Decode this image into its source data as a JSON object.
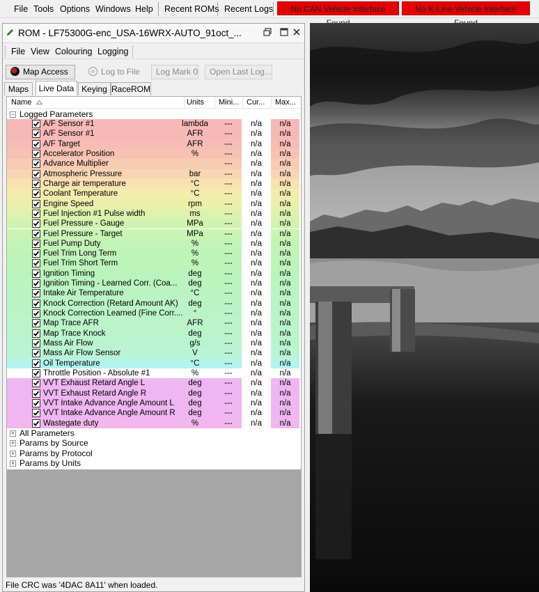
{
  "app_menu": {
    "items": [
      "File",
      "Tools",
      "Options",
      "Windows",
      "Help",
      "Recent ROMs",
      "Recent Logs"
    ],
    "errors": [
      "No CAN Vehicle Interface Found",
      "No K-Line Vehicle Interface Found"
    ]
  },
  "rom_window": {
    "title": "ROM - LF75300G-enc_USA-16WRX-AUTO_91oct_...",
    "menu": [
      "File",
      "View",
      "Colouring",
      "Logging"
    ],
    "toolbar": {
      "map_access": "Map Access",
      "log_to_file": "Log to File",
      "log_mark": "Log Mark 0",
      "open_last_log": "Open Last Log..."
    },
    "tabs": [
      "Maps",
      "Live Data",
      "Keying",
      "RaceROM"
    ],
    "active_tab": "Live Data",
    "columns": [
      "Name",
      "Units",
      "Mini...",
      "Cur...",
      "Max..."
    ],
    "tree_root": "Logged Parameters",
    "parameters": [
      {
        "name": "A/F Sensor #1",
        "units": "lambda",
        "min": "---",
        "cur": "n/a",
        "max": "n/a",
        "color": "#f7b9b6"
      },
      {
        "name": "A/F Sensor #1",
        "units": "AFR",
        "min": "---",
        "cur": "n/a",
        "max": "n/a",
        "color": "#f7b9b6"
      },
      {
        "name": "A/F Target",
        "units": "AFR",
        "min": "---",
        "cur": "n/a",
        "max": "n/a",
        "color": "#f7bcb3"
      },
      {
        "name": "Accelerator Position",
        "units": "%",
        "min": "---",
        "cur": "n/a",
        "max": "n/a",
        "color": "#f8c2b3"
      },
      {
        "name": "Advance Multiplier",
        "units": "",
        "min": "---",
        "cur": "n/a",
        "max": "n/a",
        "color": "#f8cbb3"
      },
      {
        "name": "Atmospheric Pressure",
        "units": "bar",
        "min": "---",
        "cur": "n/a",
        "max": "n/a",
        "color": "#f8d6b3"
      },
      {
        "name": "Charge air temperature",
        "units": "°C",
        "min": "---",
        "cur": "n/a",
        "max": "n/a",
        "color": "#f7e2b0"
      },
      {
        "name": "Coolant Temperature",
        "units": "°C",
        "min": "---",
        "cur": "n/a",
        "max": "n/a",
        "color": "#f3ecad"
      },
      {
        "name": "Engine Speed",
        "units": "rpm",
        "min": "---",
        "cur": "n/a",
        "max": "n/a",
        "color": "#eaf0ab"
      },
      {
        "name": "Fuel Injection #1 Pulse width",
        "units": "ms",
        "min": "---",
        "cur": "n/a",
        "max": "n/a",
        "color": "#ddf2ad"
      },
      {
        "name": "Fuel Pressure - Gauge",
        "units": "MPa",
        "min": "---",
        "cur": "n/a",
        "max": "n/a",
        "color": "#d1f3b0"
      },
      {
        "name": "Fuel Pressure - Target",
        "units": "MPa",
        "min": "---",
        "cur": "n/a",
        "max": "n/a",
        "color": "#c9f4b3"
      },
      {
        "name": "Fuel Pump Duty",
        "units": "%",
        "min": "---",
        "cur": "n/a",
        "max": "n/a",
        "color": "#c3f4b6"
      },
      {
        "name": "Fuel Trim Long Term",
        "units": "%",
        "min": "---",
        "cur": "n/a",
        "max": "n/a",
        "color": "#bff4b8"
      },
      {
        "name": "Fuel Trim Short Term",
        "units": "%",
        "min": "---",
        "cur": "n/a",
        "max": "n/a",
        "color": "#bcf4ba"
      },
      {
        "name": "Ignition Timing",
        "units": "deg",
        "min": "---",
        "cur": "n/a",
        "max": "n/a",
        "color": "#baf4bc"
      },
      {
        "name": "Ignition Timing - Learned Corr. (Coa...",
        "units": "deg",
        "min": "---",
        "cur": "n/a",
        "max": "n/a",
        "color": "#baf4bf"
      },
      {
        "name": "Intake Air Temperature",
        "units": "°C",
        "min": "---",
        "cur": "n/a",
        "max": "n/a",
        "color": "#baf4c2"
      },
      {
        "name": "Knock Correction (Retard Amount AK)",
        "units": "deg",
        "min": "---",
        "cur": "n/a",
        "max": "n/a",
        "color": "#baf4c4"
      },
      {
        "name": "Knock Correction Learned (Fine Corr....",
        "units": "°",
        "min": "---",
        "cur": "n/a",
        "max": "n/a",
        "color": "#baf4c6"
      },
      {
        "name": "Map Trace AFR",
        "units": "AFR",
        "min": "---",
        "cur": "n/a",
        "max": "n/a",
        "color": "#baf4c8"
      },
      {
        "name": "Map Trace Knock",
        "units": "deg",
        "min": "---",
        "cur": "n/a",
        "max": "n/a",
        "color": "#baf4cb"
      },
      {
        "name": "Mass Air Flow",
        "units": "g/s",
        "min": "---",
        "cur": "n/a",
        "max": "n/a",
        "color": "#baf4ce"
      },
      {
        "name": "Mass Air Flow Sensor",
        "units": "V",
        "min": "---",
        "cur": "n/a",
        "max": "n/a",
        "color": "#baf4d2"
      },
      {
        "name": "Oil Temperature",
        "units": "°C",
        "min": "---",
        "cur": "n/a",
        "max": "n/a",
        "color": "#b3f4ee"
      },
      {
        "name": "Throttle Position - Absolute #1",
        "units": "%",
        "min": "---",
        "cur": "n/a",
        "max": "n/a",
        "color": "#ffffff"
      },
      {
        "name": "VVT Exhaust Retard Angle L",
        "units": "deg",
        "min": "---",
        "cur": "n/a",
        "max": "n/a",
        "color": "#eeb6f2"
      },
      {
        "name": "VVT Exhaust Retard Angle R",
        "units": "deg",
        "min": "---",
        "cur": "n/a",
        "max": "n/a",
        "color": "#eeb6f2"
      },
      {
        "name": "VVT Intake Advance Angle Amount L",
        "units": "deg",
        "min": "---",
        "cur": "n/a",
        "max": "n/a",
        "color": "#efb6f1"
      },
      {
        "name": "VVT Intake Advance Angle Amount R",
        "units": "deg",
        "min": "---",
        "cur": "n/a",
        "max": "n/a",
        "color": "#efb6f1"
      },
      {
        "name": "Wastegate duty",
        "units": "%",
        "min": "---",
        "cur": "n/a",
        "max": "n/a",
        "color": "#f3b6ee"
      }
    ],
    "other_groups": [
      "All Parameters",
      "Params by Source",
      "Params by Protocol",
      "Params by Units"
    ],
    "status": "File CRC was '4DAC 8A11' when loaded."
  },
  "colors": {
    "error_bg": "#e50000",
    "grid_grey": "#a6a6a6"
  }
}
